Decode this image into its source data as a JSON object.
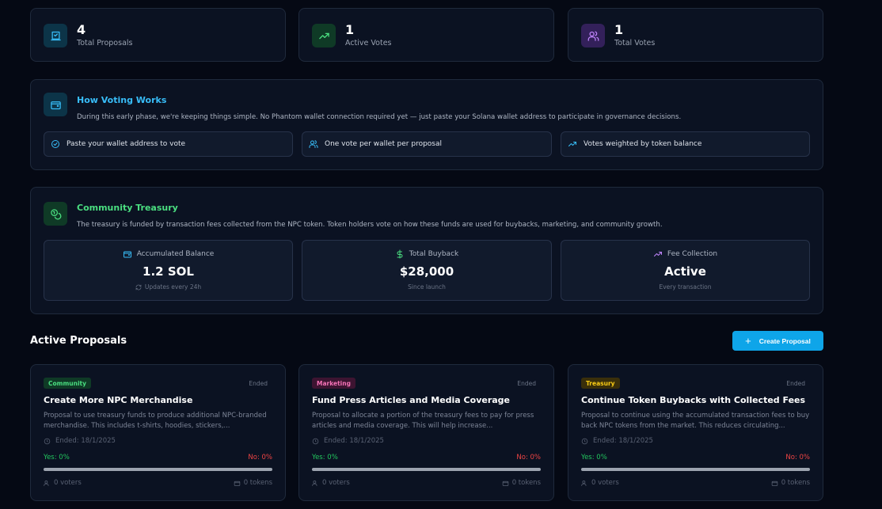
{
  "stats": [
    {
      "value": "4",
      "label": "Total Proposals",
      "icon": "ballot-box-icon"
    },
    {
      "value": "1",
      "label": "Active Votes",
      "icon": "trending-up-icon"
    },
    {
      "value": "1",
      "label": "Total Votes",
      "icon": "users-icon"
    }
  ],
  "voting": {
    "title": "How Voting Works",
    "description": "During this early phase, we're keeping things simple. No Phantom wallet connection required yet — just paste your Solana wallet address to participate in governance decisions.",
    "steps": [
      "Paste your wallet address to vote",
      "One vote per wallet per proposal",
      "Votes weighted by token balance"
    ]
  },
  "treasury": {
    "title": "Community Treasury",
    "description": "The treasury is funded by transaction fees collected from the NPC token. Token holders vote on how these funds are used for buybacks, marketing, and community growth.",
    "boxes": [
      {
        "label": "Accumulated Balance",
        "value": "1.2 SOL",
        "sub": "Updates every 24h"
      },
      {
        "label": "Total Buyback",
        "value": "$28,000",
        "sub": "Since launch"
      },
      {
        "label": "Fee Collection",
        "value": "Active",
        "sub": "Every transaction"
      }
    ]
  },
  "proposals": {
    "heading": "Active Proposals",
    "create_label": "Create Proposal",
    "items": [
      {
        "tag": "Community",
        "status": "Ended",
        "title": "Create More NPC Merchandise",
        "description": "Proposal to use treasury funds to produce additional NPC-branded merchandise. This includes t-shirts, hoodies, stickers,...",
        "ended": "Ended: 18/1/2025",
        "yes": "Yes: 0%",
        "no": "No: 0%",
        "voters": "0 voters",
        "tokens": "0 tokens"
      },
      {
        "tag": "Marketing",
        "status": "Ended",
        "title": "Fund Press Articles and Media Coverage",
        "description": "Proposal to allocate a portion of the treasury fees to pay for press articles and media coverage. This will help increase...",
        "ended": "Ended: 18/1/2025",
        "yes": "Yes: 0%",
        "no": "No: 0%",
        "voters": "0 voters",
        "tokens": "0 tokens"
      },
      {
        "tag": "Treasury",
        "status": "Ended",
        "title": "Continue Token Buybacks with Collected Fees",
        "description": "Proposal to continue using the accumulated transaction fees to buy back NPC tokens from the market. This reduces circulating...",
        "ended": "Ended: 18/1/2025",
        "yes": "Yes: 0%",
        "no": "No: 0%",
        "voters": "0 voters",
        "tokens": "0 tokens"
      }
    ]
  },
  "colors": {
    "accent_blue": "#0ea5e9",
    "title_blue": "#38bdf8",
    "title_green": "#4ade80",
    "yes_green": "#22c55e",
    "no_red": "#ef4444"
  }
}
